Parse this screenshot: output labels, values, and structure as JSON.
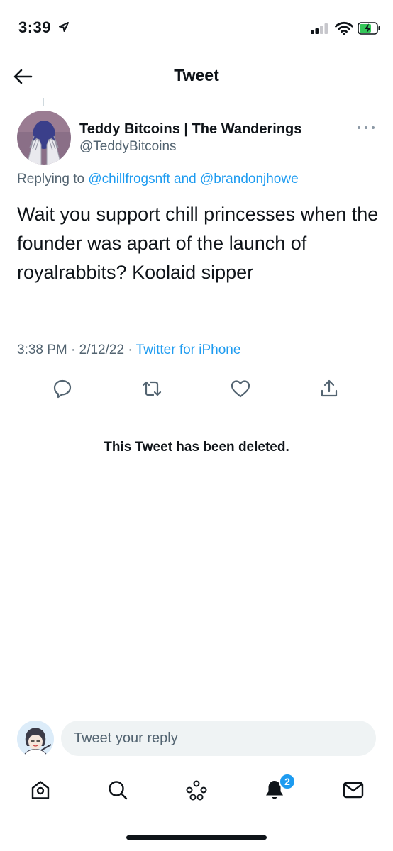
{
  "status_bar": {
    "time": "3:39",
    "battery_color": "#34c759"
  },
  "nav": {
    "title": "Tweet"
  },
  "tweet": {
    "author_name": "Teddy Bitcoins | The Wanderings",
    "author_handle": "@TeddyBitcoins",
    "replying_prefix": "Replying to",
    "replying_to": [
      "@chillfrogsnft",
      "@brandonjhowe"
    ],
    "replying_joiner": "and",
    "text": "Wait you support chill princesses when the founder was apart of the launch of royalrabbits? Koolaid sipper",
    "timestamp": "3:38 PM · 2/12/22 ·",
    "source": "Twitter for iPhone"
  },
  "actions": [
    "reply-icon",
    "retweet-icon",
    "like-icon",
    "share-icon"
  ],
  "deleted_notice": "This Tweet has been deleted.",
  "reply_box": {
    "placeholder": "Tweet your reply"
  },
  "tab_bar": {
    "items": [
      "home-icon",
      "search-icon",
      "spaces-icon",
      "notifications-icon",
      "messages-icon"
    ],
    "notifications_badge": "2"
  },
  "colors": {
    "accent": "#1d9bf0",
    "secondary_text": "#536471",
    "primary_text": "#0f1419"
  }
}
